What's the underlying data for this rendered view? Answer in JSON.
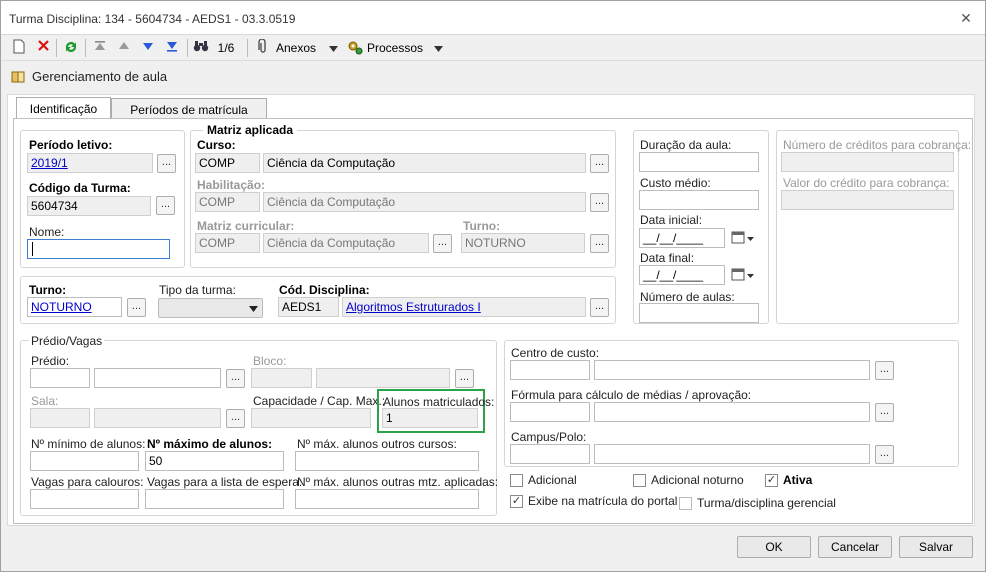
{
  "window": {
    "title": "Turma Disciplina: 134 - 5604734 - AEDS1 - 03.3.0519",
    "close": "✕"
  },
  "toolbar": {
    "page_indicator": "1/6",
    "anexos": "Anexos",
    "processos": "Processos"
  },
  "header": {
    "title": "Gerenciamento de aula"
  },
  "tabs": [
    {
      "label": "Identificação"
    },
    {
      "label": "Períodos de matrícula"
    }
  ],
  "periodo": {
    "label": "Período letivo:",
    "value": "2019/1"
  },
  "codigo_turma": {
    "label": "Código da Turma:",
    "value": "5604734"
  },
  "nome": {
    "label": "Nome:",
    "value": ""
  },
  "matriz": {
    "title": "Matriz aplicada",
    "curso": {
      "label": "Curso:",
      "code": "COMP",
      "name": "Ciência da Computação"
    },
    "habilitacao": {
      "label": "Habilitação:",
      "code": "COMP",
      "name": "Ciência da Computação"
    },
    "matriz_curricular": {
      "label": "Matriz curricular:",
      "code": "COMP",
      "name": "Ciência da Computação"
    },
    "turno": {
      "label": "Turno:",
      "value": "NOTURNO"
    }
  },
  "aula": {
    "duracao": "Duração da aula:",
    "custo": "Custo médio:",
    "data_inicial": "Data inicial:",
    "data_final": "Data final:",
    "numero_aulas": "Número de aulas:",
    "date_mask": "__/__/____"
  },
  "creditos": {
    "numero": "Número de créditos para cobrança:",
    "valor": "Valor do crédito para cobrança:"
  },
  "turno": {
    "label": "Turno:",
    "value": "NOTURNO"
  },
  "tipo_turma": {
    "label": "Tipo da turma:"
  },
  "disciplina": {
    "label": "Cód. Disciplina:",
    "code": "AEDS1",
    "name": "Algoritmos Estruturados I"
  },
  "predio_vagas": {
    "title": "Prédio/Vagas",
    "predio": "Prédio:",
    "bloco": "Bloco:",
    "sala": "Sala:",
    "capacidade": "Capacidade / Cap. Max.:",
    "alunos_matriculados": {
      "label": "Alunos matriculados:",
      "value": "1"
    },
    "min_alunos": "Nº mínimo de alunos:",
    "max_alunos": {
      "label": "Nº máximo de alunos:",
      "value": "50"
    },
    "max_outros_cursos": "Nº máx. alunos outros cursos:",
    "vagas_calouros": "Vagas para calouros:",
    "vagas_espera": "Vagas para a lista de espera:",
    "max_outras_mtz": "Nº máx. alunos outras mtz. aplicadas:"
  },
  "custo": {
    "centro": "Centro de custo:",
    "formula": "Fórmula para cálculo de médias / aprovação:",
    "campus": "Campus/Polo:"
  },
  "checks": {
    "adicional": "Adicional",
    "adicional_noturno": "Adicional noturno",
    "ativa": "Ativa",
    "exibe": "Exibe na matrícula do portal",
    "gerencial": "Turma/disciplina gerencial",
    "check_mark": "✓"
  },
  "buttons": {
    "ok": "OK",
    "cancelar": "Cancelar",
    "salvar": "Salvar",
    "dots": "..."
  },
  "colors": {
    "highlight": "#2aa34a",
    "link": "#0000cc"
  }
}
